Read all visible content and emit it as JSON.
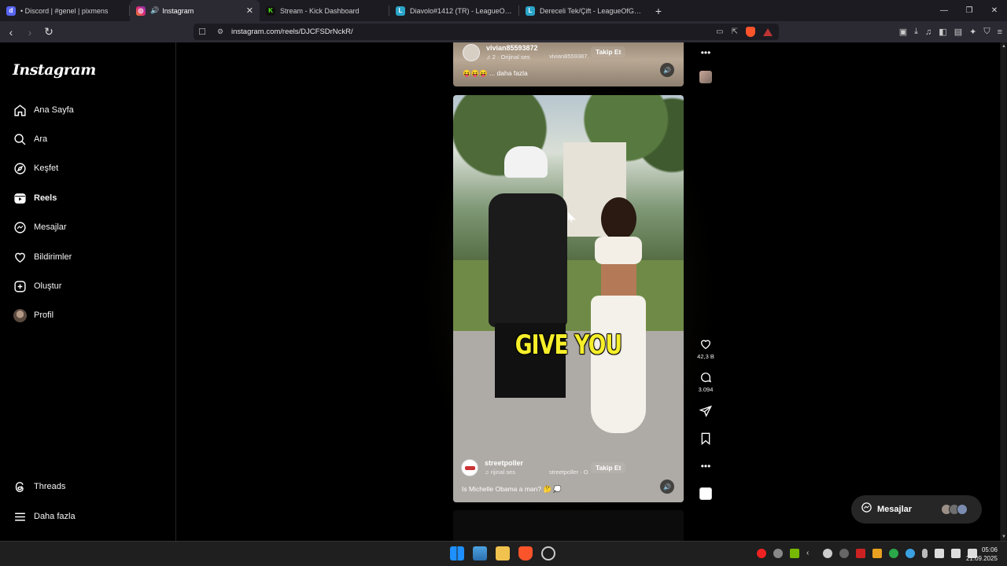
{
  "browser": {
    "tabs": [
      {
        "label": "• Discord | #genel | pixmens",
        "active": false,
        "icon": "discord-icon"
      },
      {
        "label": "Instagram",
        "active": true,
        "icon": "instagram-icon"
      },
      {
        "label": "Stream - Kick Dashboard",
        "active": false,
        "icon": "kick-icon"
      },
      {
        "label": "Diavolo#1412 (TR) - LeagueOfGraphs",
        "active": false,
        "icon": "leagueofgraphs-icon"
      },
      {
        "label": "Dereceli Tek/Çift - LeagueOfGraphs.c",
        "active": false,
        "icon": "leagueofgraphs-icon"
      }
    ],
    "url": "instagram.com/reels/DJCFSDrNckR/"
  },
  "sidebar": {
    "logo": "Instagram",
    "items": [
      {
        "label": "Ana Sayfa",
        "icon": "home-icon"
      },
      {
        "label": "Ara",
        "icon": "search-icon"
      },
      {
        "label": "Keşfet",
        "icon": "compass-icon"
      },
      {
        "label": "Reels",
        "icon": "reels-icon"
      },
      {
        "label": "Mesajlar",
        "icon": "messenger-icon"
      },
      {
        "label": "Bildirimler",
        "icon": "heart-icon"
      },
      {
        "label": "Oluştur",
        "icon": "plus-square-icon"
      },
      {
        "label": "Profil",
        "icon": "avatar"
      }
    ],
    "bottom": [
      {
        "label": "Threads",
        "icon": "threads-icon"
      },
      {
        "label": "Daha fazla",
        "icon": "menu-icon"
      }
    ]
  },
  "reels": {
    "previous": {
      "username": "vivian85593872",
      "audio": "2 · Orijinal ses",
      "audio_scroll": "vivian8559387.",
      "follow": "Takip Et",
      "caption": "😝😝😝 ... daha fazla"
    },
    "current": {
      "username": "streetpoller",
      "audio": "rijinal ses",
      "audio_scroll": "streetpoller · O",
      "follow": "Takip Et",
      "caption": "Is Michelle Obama a man? 🤔 💭",
      "subtitle": "GIVE YOU",
      "likes": "42,3 B",
      "comments": "3.094"
    }
  },
  "messages_pill": {
    "label": "Mesajlar"
  },
  "taskbar": {
    "time": "05:06",
    "date": "21.09.2025"
  },
  "colors": {
    "subtitle": "#f6ef2a",
    "background": "#000000",
    "accent_red": "#fb542b"
  }
}
